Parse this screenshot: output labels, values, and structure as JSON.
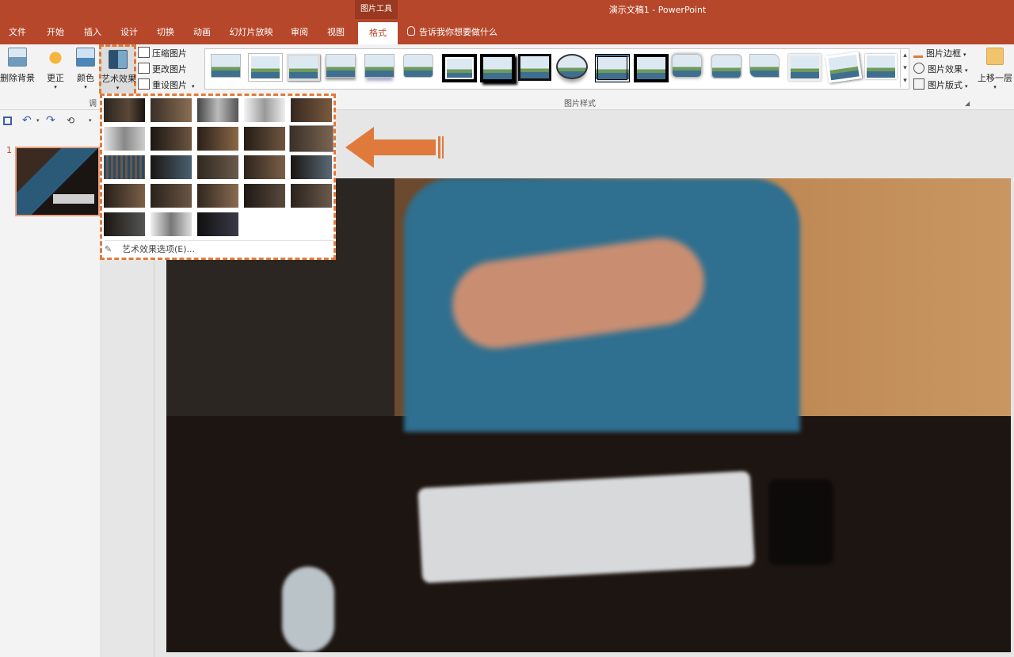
{
  "titlebar": {
    "contextual_tab_group": "图片工具",
    "document_title": "演示文稿1 - PowerPoint"
  },
  "ribbon_tabs": [
    {
      "label": "文件"
    },
    {
      "label": "开始"
    },
    {
      "label": "插入"
    },
    {
      "label": "设计"
    },
    {
      "label": "切换"
    },
    {
      "label": "动画"
    },
    {
      "label": "幻灯片放映"
    },
    {
      "label": "审阅"
    },
    {
      "label": "视图"
    },
    {
      "label": "格式",
      "active": true
    }
  ],
  "tell_me": "告诉我你想要做什么",
  "adjust_group": {
    "remove_background": "删除背景",
    "corrections": "更正",
    "color": "颜色",
    "artistic_effects": "艺术效果",
    "compress": "压缩图片",
    "change": "更改图片",
    "reset": "重设图片",
    "group_label_partial": "调"
  },
  "picture_styles": {
    "group_label": "图片样式",
    "border": "图片边框",
    "effects": "图片效果",
    "layout": "图片版式"
  },
  "arrange_group": {
    "bring_forward": "上移一层"
  },
  "slides_pane": {
    "slide_number": "1"
  },
  "art_effects_menu": {
    "options_label": "艺术效果选项(E)..."
  },
  "colors": {
    "accent": "#b7472a",
    "highlight": "#e07a3c",
    "ribbon_bg": "#f3f3f3"
  }
}
